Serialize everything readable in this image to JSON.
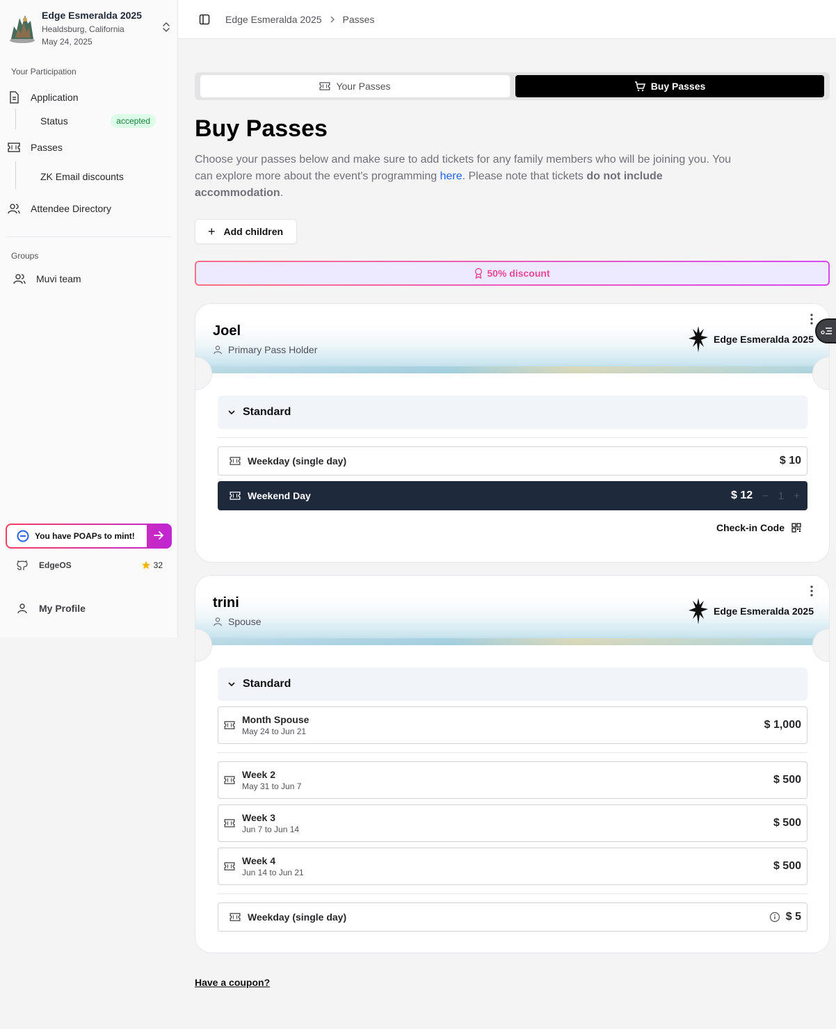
{
  "sidebar": {
    "event": {
      "name": "Edge Esmeralda 2025",
      "location": "Healdsburg, California",
      "date": "May 24, 2025"
    },
    "participation_label": "Your Participation",
    "application_label": "Application",
    "status_label": "Status",
    "status_value": "accepted",
    "passes_label": "Passes",
    "zk_label": "ZK Email discounts",
    "directory_label": "Attendee Directory",
    "groups_label": "Groups",
    "group_item": "Muvi team",
    "poap_text": "You have POAPs to mint!",
    "github_label": "EdgeOS",
    "github_stars": "32",
    "profile_label": "My Profile"
  },
  "breadcrumb": {
    "event": "Edge Esmeralda 2025",
    "page": "Passes"
  },
  "tabs": {
    "your": "Your Passes",
    "buy": "Buy Passes"
  },
  "main": {
    "title": "Buy Passes",
    "desc_1": "Choose your passes below and make sure to add tickets for any family members who will be joining you. You can explore more about the event's programming ",
    "desc_link": "here",
    "desc_2": ". Please note that tickets ",
    "desc_bold": "do not include accommodation",
    "desc_3": ".",
    "add_children": "Add children",
    "discount": "50% discount",
    "coupon": "Have a coupon?"
  },
  "cards": [
    {
      "name": "Joel",
      "role": "Primary Pass Holder",
      "brand": "Edge Esmeralda 2025",
      "section": "Standard",
      "rows": [
        {
          "label": "Weekday (single day)",
          "price": "$ 10"
        },
        {
          "label": "Weekend Day",
          "price": "$ 12",
          "qty": "1",
          "minus": "−",
          "plus": "+"
        }
      ],
      "checkin": "Check-in Code"
    },
    {
      "name": "trini",
      "role": "Spouse",
      "brand": "Edge Esmeralda 2025",
      "section": "Standard",
      "rows": [
        {
          "label": "Month Spouse",
          "sub": "May 24 to Jun 21",
          "price": "$ 1,000"
        },
        {
          "label": "Week 2",
          "sub": "May 31 to Jun 7",
          "price": "$ 500"
        },
        {
          "label": "Week 3",
          "sub": "Jun 7 to Jun 14",
          "price": "$ 500"
        },
        {
          "label": "Week 4",
          "sub": "Jun 14 to Jun 21",
          "price": "$ 500"
        },
        {
          "label": "Weekday (single day)",
          "price": "$ 5"
        }
      ]
    }
  ],
  "colors": {
    "accent": "#ec4899",
    "dark_row": "#1e293b",
    "accepted": "#15803d",
    "link": "#2563eb"
  }
}
